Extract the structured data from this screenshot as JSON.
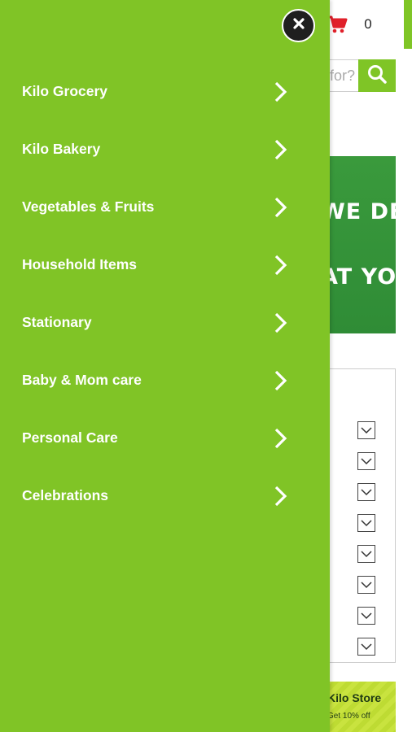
{
  "header": {
    "cart_count": "0"
  },
  "search": {
    "placeholder": "What are you looking for?"
  },
  "banner": {
    "line1": "WE DELIVER",
    "line2": "AT YOUR HOME"
  },
  "promo": {
    "title": "Kilo Store",
    "subtitle": "Get 10% off"
  },
  "drawer": {
    "items": [
      {
        "label": "Kilo Grocery"
      },
      {
        "label": "Kilo Bakery"
      },
      {
        "label": "Vegetables & Fruits"
      },
      {
        "label": "Household Items"
      },
      {
        "label": "Stationary"
      },
      {
        "label": "Baby & Mom care"
      },
      {
        "label": "Personal Care"
      },
      {
        "label": "Celebrations"
      }
    ]
  },
  "colors": {
    "accent": "#80c426",
    "cart": "#e0202a",
    "banner": "#3a9a3c",
    "close": "#1f1f1f"
  }
}
